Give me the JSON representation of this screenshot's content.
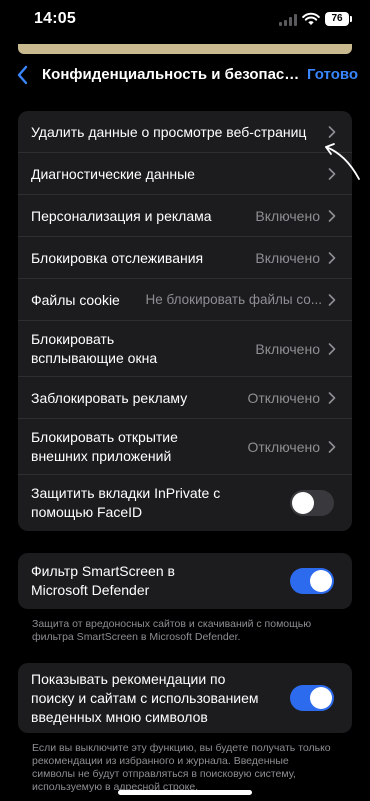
{
  "status": {
    "time": "14:05",
    "battery": "76"
  },
  "nav": {
    "title": "Конфиденциальность и безопасн...",
    "done": "Готово"
  },
  "privacy_rows": [
    {
      "label": "Удалить данные о просмотре веб-страниц",
      "value": ""
    },
    {
      "label": "Диагностические данные",
      "value": ""
    },
    {
      "label": "Персонализация и реклама",
      "value": "Включено"
    },
    {
      "label": "Блокировка отслеживания",
      "value": "Включено"
    },
    {
      "label": "Файлы cookie",
      "value": "Не блокировать файлы со..."
    },
    {
      "label": "Блокировать\nвсплывающие окна",
      "value": "Включено"
    },
    {
      "label": "Заблокировать рекламу",
      "value": "Отключено"
    },
    {
      "label": "Блокировать открытие\nвнешних приложений",
      "value": "Отключено"
    },
    {
      "label": "Защитить вкладки InPrivate с\nпомощью FaceID",
      "toggle": "off"
    }
  ],
  "smartscreen": {
    "label": "Фильтр SmartScreen в\nMicrosoft Defender",
    "toggle": "on",
    "footnote": "Защита от вредоносных сайтов и скачиваний с помощью фильтра SmartScreen в Microsoft Defender."
  },
  "suggestions": {
    "label": "Показывать рекомендации по\nпоиску и сайтам с использованием\nвведенных мною символов",
    "toggle": "on",
    "footnote": "Если вы выключите эту функцию, вы будете получать только рекомендации из избранного и журнала. Введенные символы не будут отправляться в поисковую систему, используемую в адресной строке."
  },
  "colors": {
    "accent": "#2c6bed",
    "link": "#3a86ff",
    "group_bg": "#1c1c1e",
    "secondary_text": "#8e8e93"
  }
}
